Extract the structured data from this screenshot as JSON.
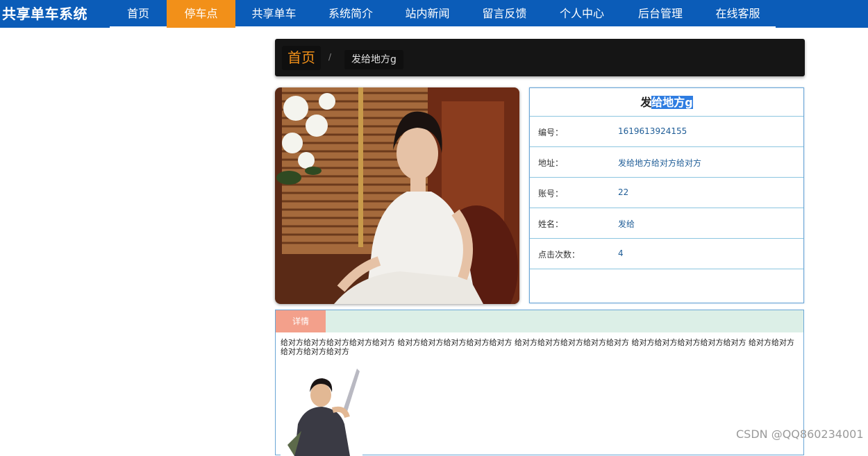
{
  "brand": "共享单车系统",
  "nav": [
    {
      "label": "首页",
      "width": 82
    },
    {
      "label": "停车点",
      "width": 99,
      "active": true
    },
    {
      "label": "共享单车",
      "width": 111
    },
    {
      "label": "系统简介",
      "width": 110
    },
    {
      "label": "站内新闻",
      "width": 111
    },
    {
      "label": "留言反馈",
      "width": 111
    },
    {
      "label": "个人中心",
      "width": 112
    },
    {
      "label": "后台管理",
      "width": 114
    },
    {
      "label": "在线客服",
      "width": 109
    }
  ],
  "breadcrumb": {
    "home": "首页",
    "separator": "/",
    "current": "发给地方g"
  },
  "info": {
    "title_plain": "发",
    "title_selected": "给地方g",
    "rows": [
      {
        "label": "编号：",
        "value": "1619613924155"
      },
      {
        "label": "地址：",
        "value": "发给地方给对方给对方"
      },
      {
        "label": "账号：",
        "value": "22"
      },
      {
        "label": "姓名：",
        "value": "发给"
      },
      {
        "label": "点击次数：",
        "value": "4"
      }
    ]
  },
  "detail": {
    "tab": "详情",
    "text": "给对方给对方给对方给对方给对方 给对方给对方给对方给对方给对方 给对方给对方给对方给对方给对方 给对方给对方给对方给对方给对方 给对方给对方给对方给对方给对方"
  },
  "watermark": "CSDN @QQ860234001"
}
